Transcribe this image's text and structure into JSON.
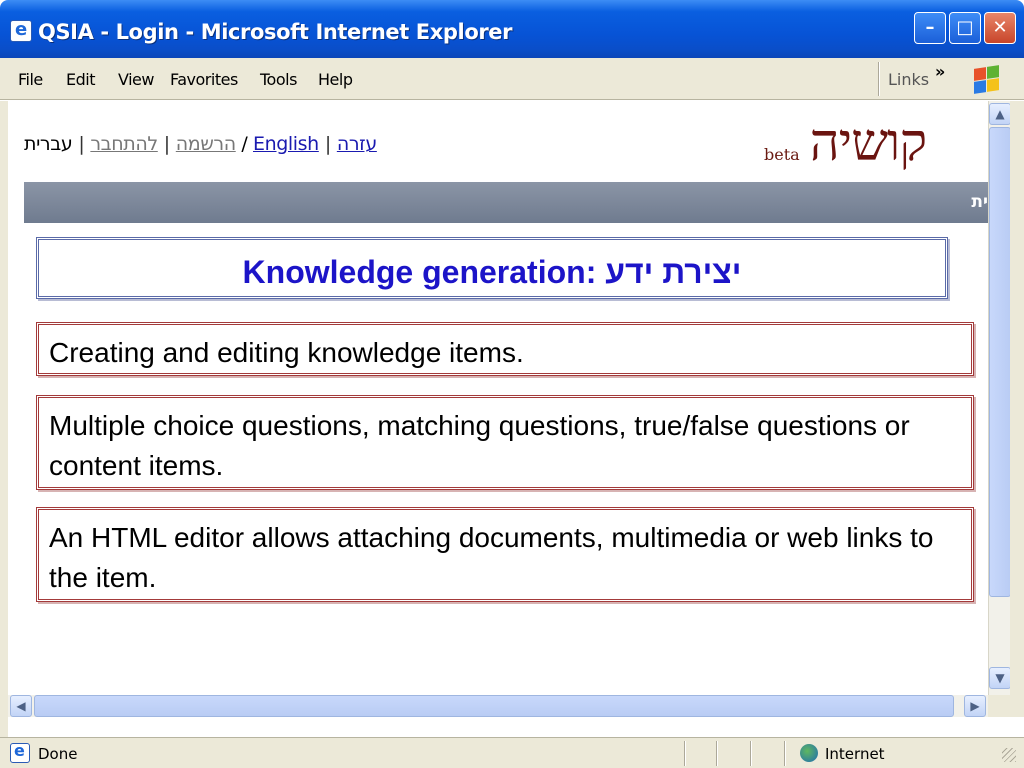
{
  "window": {
    "title": "QSIA - Login - Microsoft Internet Explorer",
    "min_glyph": "–",
    "max_glyph": "□",
    "close_glyph": "✕"
  },
  "menu": {
    "items": [
      "File",
      "Edit",
      "View",
      "Favorites",
      "Tools",
      "Help"
    ],
    "links_label": "Links",
    "chevron": "»"
  },
  "page": {
    "toplinks": {
      "register": "הרשמה",
      "login": "להתחבר",
      "hebrew": "עברית",
      "slash": " / ",
      "english": "English",
      "help": "עזרה",
      "sep": "|"
    },
    "logo": {
      "beta": "beta",
      "name": "קושיה"
    },
    "graybar_text": "ית"
  },
  "slide": {
    "heading": "Knowledge generation: יצירת ידע",
    "items": [
      "Creating and editing knowledge items.",
      "Multiple choice questions, matching questions, true/false questions or content items.",
      "An HTML editor allows attaching documents, multimedia or web links to the item."
    ]
  },
  "scroll": {
    "up": "▲",
    "down": "▼",
    "left": "◀",
    "right": "▶"
  },
  "status": {
    "text": "Done",
    "zone": "Internet"
  },
  "colors": {
    "title_bar": "#0753d6",
    "heading_text": "#1c14c8",
    "box_border": "#a33a3a",
    "logo": "#6a1410"
  }
}
